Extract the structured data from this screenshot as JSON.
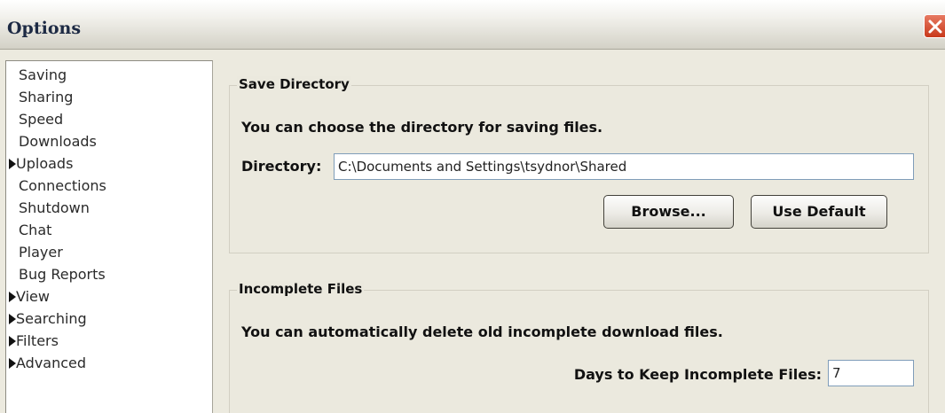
{
  "window": {
    "title": "Options",
    "close_icon": "close-x-icon"
  },
  "sidebar": {
    "items": [
      {
        "label": "Saving",
        "expandable": false
      },
      {
        "label": "Sharing",
        "expandable": false
      },
      {
        "label": "Speed",
        "expandable": false
      },
      {
        "label": "Downloads",
        "expandable": false
      },
      {
        "label": "Uploads",
        "expandable": true
      },
      {
        "label": "Connections",
        "expandable": false
      },
      {
        "label": "Shutdown",
        "expandable": false
      },
      {
        "label": "Chat",
        "expandable": false
      },
      {
        "label": "Player",
        "expandable": false
      },
      {
        "label": "Bug Reports",
        "expandable": false
      },
      {
        "label": "View",
        "expandable": true
      },
      {
        "label": "Searching",
        "expandable": true
      },
      {
        "label": "Filters",
        "expandable": true
      },
      {
        "label": "Advanced",
        "expandable": true
      }
    ]
  },
  "save_directory": {
    "title": "Save Directory",
    "description": "You can choose the directory for saving files.",
    "directory_label": "Directory:",
    "directory_value": "C:\\Documents and Settings\\tsydnor\\Shared",
    "browse_label": "Browse...",
    "use_default_label": "Use Default"
  },
  "incomplete_files": {
    "title": "Incomplete Files",
    "description": "You can automatically delete old incomplete download files.",
    "days_label": "Days to Keep Incomplete Files:",
    "days_value": "7"
  },
  "colors": {
    "window_bg": "#eceadf",
    "close_button": "#c8391b",
    "title_text": "#1d2a44"
  }
}
